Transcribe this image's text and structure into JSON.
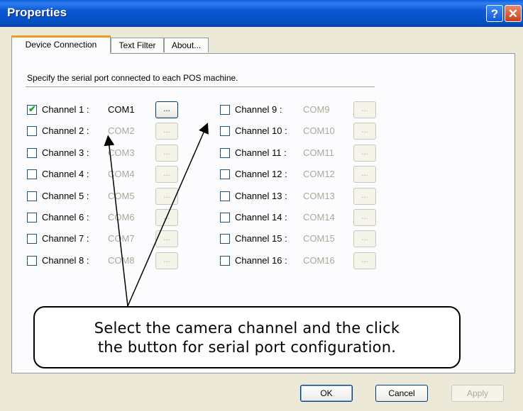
{
  "window": {
    "title": "Properties",
    "help_glyph": "?",
    "close_glyph": "✕"
  },
  "tabs": [
    {
      "label": "Device Connection",
      "active": true
    },
    {
      "label": "Text Filter",
      "active": false
    },
    {
      "label": "About...",
      "active": false
    }
  ],
  "instruction": "Specify the serial port connected to each POS machine.",
  "browse_label": "...",
  "channels_left": [
    {
      "label": "Channel 1 :",
      "port": "COM1",
      "checked": true
    },
    {
      "label": "Channel 2 :",
      "port": "COM2",
      "checked": false
    },
    {
      "label": "Channel 3 :",
      "port": "COM3",
      "checked": false
    },
    {
      "label": "Channel 4 :",
      "port": "COM4",
      "checked": false
    },
    {
      "label": "Channel 5 :",
      "port": "COM5",
      "checked": false
    },
    {
      "label": "Channel 6 :",
      "port": "COM6",
      "checked": false
    },
    {
      "label": "Channel 7 :",
      "port": "COM7",
      "checked": false
    },
    {
      "label": "Channel 8 :",
      "port": "COM8",
      "checked": false
    }
  ],
  "channels_right": [
    {
      "label": "Channel 9 :",
      "port": "COM9",
      "checked": false
    },
    {
      "label": "Channel 10 :",
      "port": "COM10",
      "checked": false
    },
    {
      "label": "Channel 11 :",
      "port": "COM11",
      "checked": false
    },
    {
      "label": "Channel 12 :",
      "port": "COM12",
      "checked": false
    },
    {
      "label": "Channel 13 :",
      "port": "COM13",
      "checked": false
    },
    {
      "label": "Channel 14 :",
      "port": "COM14",
      "checked": false
    },
    {
      "label": "Channel 15 :",
      "port": "COM15",
      "checked": false
    },
    {
      "label": "Channel 16 :",
      "port": "COM16",
      "checked": false
    }
  ],
  "callout": {
    "line1": "Select the camera channel and the click",
    "line2": "the button for serial port configuration."
  },
  "buttons": {
    "ok": "OK",
    "cancel": "Cancel",
    "apply": "Apply"
  },
  "colors": {
    "titlebar": "#0650c6",
    "tab_highlight": "#e9a020",
    "dialog_bg": "#ece9d8",
    "check": "#21a121"
  }
}
